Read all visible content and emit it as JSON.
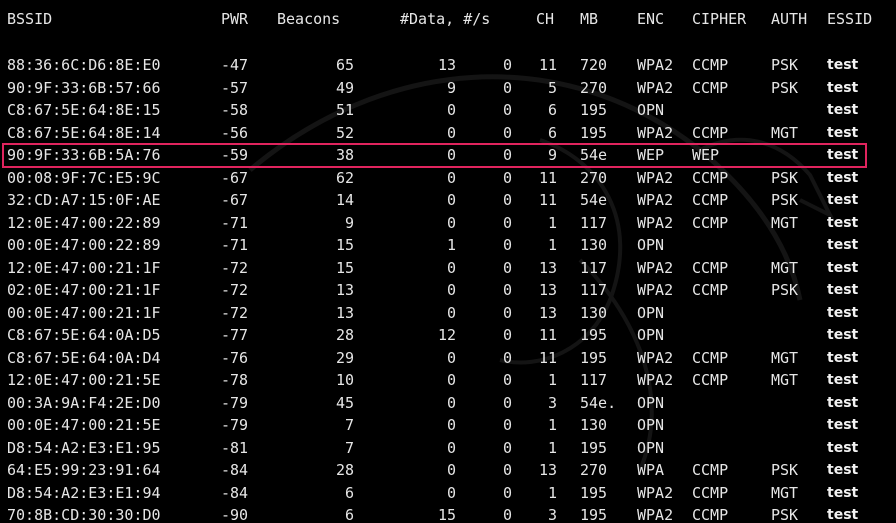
{
  "headers": {
    "bssid": "BSSID",
    "pwr": "PWR",
    "beacons": "Beacons",
    "data_rate": "#Data, #/s",
    "ch": "CH",
    "mb": "MB",
    "enc": "ENC",
    "cipher": "CIPHER",
    "auth": "AUTH",
    "essid": "ESSID"
  },
  "rows": [
    {
      "bssid": "88:36:6C:D6:8E:E0",
      "pwr": "-47",
      "beacons": "65",
      "data": "13",
      "rate": "0",
      "ch": "11",
      "mb": "720",
      "enc": "WPA2",
      "cipher": "CCMP",
      "auth": "PSK",
      "essid": "test"
    },
    {
      "bssid": "90:9F:33:6B:57:66",
      "pwr": "-57",
      "beacons": "49",
      "data": "9",
      "rate": "0",
      "ch": "5",
      "mb": "270",
      "enc": "WPA2",
      "cipher": "CCMP",
      "auth": "PSK",
      "essid": "test"
    },
    {
      "bssid": "C8:67:5E:64:8E:15",
      "pwr": "-58",
      "beacons": "51",
      "data": "0",
      "rate": "0",
      "ch": "6",
      "mb": "195",
      "enc": "OPN",
      "cipher": "",
      "auth": "",
      "essid": "test"
    },
    {
      "bssid": "C8:67:5E:64:8E:14",
      "pwr": "-56",
      "beacons": "52",
      "data": "0",
      "rate": "0",
      "ch": "6",
      "mb": "195",
      "enc": "WPA2",
      "cipher": "CCMP",
      "auth": "MGT",
      "essid": "test"
    },
    {
      "bssid": "90:9F:33:6B:5A:76",
      "pwr": "-59",
      "beacons": "38",
      "data": "0",
      "rate": "0",
      "ch": "9",
      "mb": "54e",
      "enc": "WEP",
      "cipher": "WEP",
      "auth": "",
      "essid": "test",
      "highlighted": true
    },
    {
      "bssid": "00:08:9F:7C:E5:9C",
      "pwr": "-67",
      "beacons": "62",
      "data": "0",
      "rate": "0",
      "ch": "11",
      "mb": "270",
      "enc": "WPA2",
      "cipher": "CCMP",
      "auth": "PSK",
      "essid": "test"
    },
    {
      "bssid": "32:CD:A7:15:0F:AE",
      "pwr": "-67",
      "beacons": "14",
      "data": "0",
      "rate": "0",
      "ch": "11",
      "mb": "54e",
      "enc": "WPA2",
      "cipher": "CCMP",
      "auth": "PSK",
      "essid": "test"
    },
    {
      "bssid": "12:0E:47:00:22:89",
      "pwr": "-71",
      "beacons": "9",
      "data": "0",
      "rate": "0",
      "ch": "1",
      "mb": "117",
      "enc": "WPA2",
      "cipher": "CCMP",
      "auth": "MGT",
      "essid": "test"
    },
    {
      "bssid": "00:0E:47:00:22:89",
      "pwr": "-71",
      "beacons": "15",
      "data": "1",
      "rate": "0",
      "ch": "1",
      "mb": "130",
      "enc": "OPN",
      "cipher": "",
      "auth": "",
      "essid": "test"
    },
    {
      "bssid": "12:0E:47:00:21:1F",
      "pwr": "-72",
      "beacons": "15",
      "data": "0",
      "rate": "0",
      "ch": "13",
      "mb": "117",
      "enc": "WPA2",
      "cipher": "CCMP",
      "auth": "MGT",
      "essid": "test"
    },
    {
      "bssid": "02:0E:47:00:21:1F",
      "pwr": "-72",
      "beacons": "13",
      "data": "0",
      "rate": "0",
      "ch": "13",
      "mb": "117",
      "enc": "WPA2",
      "cipher": "CCMP",
      "auth": "PSK",
      "essid": "test"
    },
    {
      "bssid": "00:0E:47:00:21:1F",
      "pwr": "-72",
      "beacons": "13",
      "data": "0",
      "rate": "0",
      "ch": "13",
      "mb": "130",
      "enc": "OPN",
      "cipher": "",
      "auth": "",
      "essid": "test"
    },
    {
      "bssid": "C8:67:5E:64:0A:D5",
      "pwr": "-77",
      "beacons": "28",
      "data": "12",
      "rate": "0",
      "ch": "11",
      "mb": "195",
      "enc": "OPN",
      "cipher": "",
      "auth": "",
      "essid": "test"
    },
    {
      "bssid": "C8:67:5E:64:0A:D4",
      "pwr": "-76",
      "beacons": "29",
      "data": "0",
      "rate": "0",
      "ch": "11",
      "mb": "195",
      "enc": "WPA2",
      "cipher": "CCMP",
      "auth": "MGT",
      "essid": "test"
    },
    {
      "bssid": "12:0E:47:00:21:5E",
      "pwr": "-78",
      "beacons": "10",
      "data": "0",
      "rate": "0",
      "ch": "1",
      "mb": "117",
      "enc": "WPA2",
      "cipher": "CCMP",
      "auth": "MGT",
      "essid": "test"
    },
    {
      "bssid": "00:3A:9A:F4:2E:D0",
      "pwr": "-79",
      "beacons": "45",
      "data": "0",
      "rate": "0",
      "ch": "3",
      "mb": "54e.",
      "enc": "OPN",
      "cipher": "",
      "auth": "",
      "essid": "test"
    },
    {
      "bssid": "00:0E:47:00:21:5E",
      "pwr": "-79",
      "beacons": "7",
      "data": "0",
      "rate": "0",
      "ch": "1",
      "mb": "130",
      "enc": "OPN",
      "cipher": "",
      "auth": "",
      "essid": "test"
    },
    {
      "bssid": "D8:54:A2:E3:E1:95",
      "pwr": "-81",
      "beacons": "7",
      "data": "0",
      "rate": "0",
      "ch": "1",
      "mb": "195",
      "enc": "OPN",
      "cipher": "",
      "auth": "",
      "essid": "test"
    },
    {
      "bssid": "64:E5:99:23:91:64",
      "pwr": "-84",
      "beacons": "28",
      "data": "0",
      "rate": "0",
      "ch": "13",
      "mb": "270",
      "enc": "WPA",
      "cipher": "CCMP",
      "auth": "PSK",
      "essid": "test"
    },
    {
      "bssid": "D8:54:A2:E3:E1:94",
      "pwr": "-84",
      "beacons": "6",
      "data": "0",
      "rate": "0",
      "ch": "1",
      "mb": "195",
      "enc": "WPA2",
      "cipher": "CCMP",
      "auth": "MGT",
      "essid": "test"
    },
    {
      "bssid": "70:8B:CD:30:30:D0",
      "pwr": "-90",
      "beacons": "6",
      "data": "15",
      "rate": "0",
      "ch": "3",
      "mb": "195",
      "enc": "WPA2",
      "cipher": "CCMP",
      "auth": "PSK",
      "essid": "test"
    }
  ],
  "colors": {
    "background": "#000000",
    "text": "#e6e6e6",
    "highlight_border": "#e0245e"
  }
}
